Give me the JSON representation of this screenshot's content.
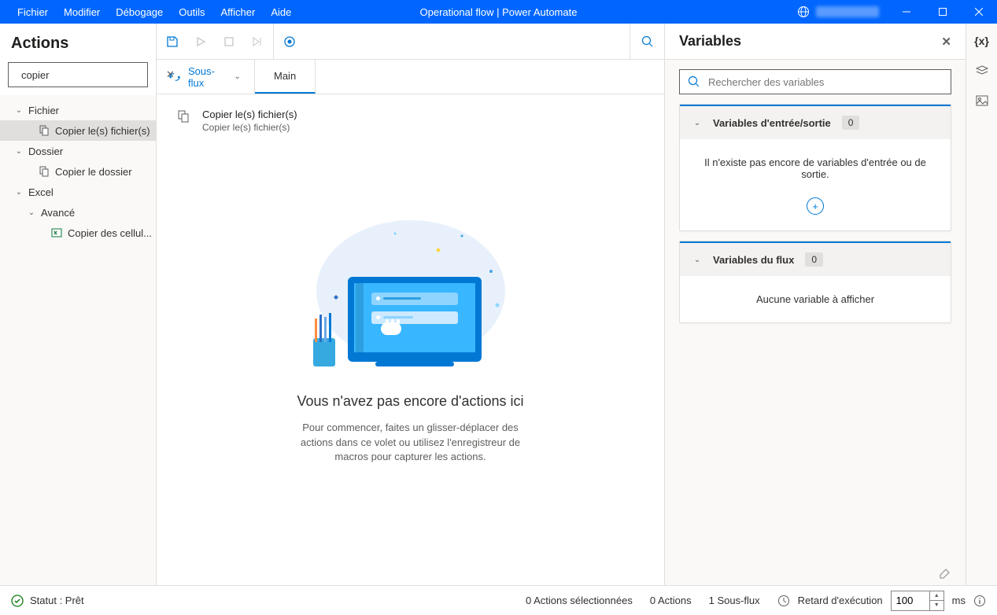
{
  "menu": {
    "items": [
      "Fichier",
      "Modifier",
      "Débogage",
      "Outils",
      "Afficher",
      "Aide"
    ]
  },
  "title": "Operational flow | Power Automate",
  "left": {
    "title": "Actions",
    "search_value": "copier",
    "tree": [
      {
        "type": "cat",
        "label": "Fichier"
      },
      {
        "type": "leaf",
        "label": "Copier le(s) fichier(s)",
        "selected": true,
        "icon": "copy"
      },
      {
        "type": "cat",
        "label": "Dossier"
      },
      {
        "type": "leaf",
        "label": "Copier le dossier",
        "icon": "copy"
      },
      {
        "type": "cat",
        "label": "Excel"
      },
      {
        "type": "subcat",
        "label": "Avancé"
      },
      {
        "type": "leaf",
        "label": "Copier des cellul...",
        "icon": "excel",
        "indent": true
      }
    ]
  },
  "subflow": {
    "button": "Sous-flux",
    "tab": "Main"
  },
  "dragged": {
    "title": "Copier le(s) fichier(s)",
    "sub": "Copier le(s) fichier(s)"
  },
  "empty": {
    "title": "Vous n'avez pas encore d'actions ici",
    "body": "Pour commencer, faites un glisser-déplacer des actions dans ce volet ou utilisez l'enregistreur de macros pour capturer les actions."
  },
  "vars": {
    "title": "Variables",
    "search_placeholder": "Rechercher des variables",
    "io": {
      "title": "Variables d'entrée/sortie",
      "count": "0",
      "empty": "Il n'existe pas encore de variables d'entrée ou de sortie."
    },
    "flow": {
      "title": "Variables du flux",
      "count": "0",
      "empty": "Aucune variable à afficher"
    }
  },
  "status": {
    "ready": "Statut : Prêt",
    "sel": "0 Actions sélectionnées",
    "act": "0 Actions",
    "sub": "1 Sous-flux",
    "delay_label": "Retard d'exécution",
    "delay_value": "100",
    "delay_unit": "ms"
  }
}
